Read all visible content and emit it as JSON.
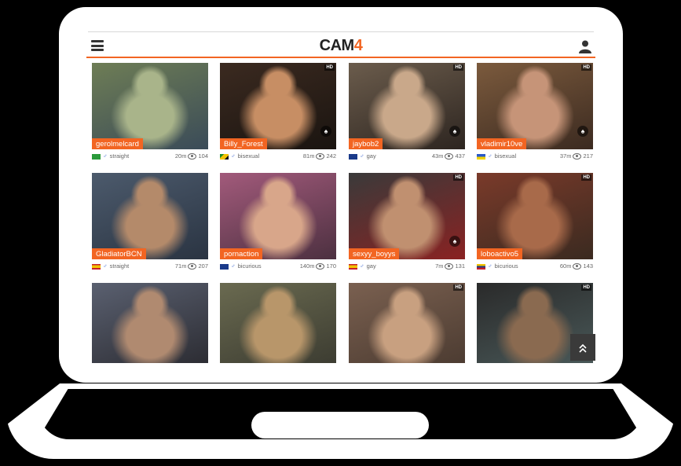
{
  "site": {
    "logo_main": "CAM",
    "logo_accent": "4",
    "accent_color": "#f26522"
  },
  "tiles": [
    {
      "name": "gerolmelcard",
      "flag": "br",
      "orientation": "straight",
      "time": "20m",
      "viewers": "104",
      "hd": "",
      "palette": [
        "#6e7d55",
        "#a9b48a",
        "#3a4b58"
      ]
    },
    {
      "name": "Billy_Forest",
      "flag": "jm",
      "orientation": "bisexual",
      "time": "81m",
      "viewers": "242",
      "hd": "HD",
      "palette": [
        "#3b2a20",
        "#c78e64",
        "#1a1410"
      ]
    },
    {
      "name": "jaybob2",
      "flag": "gb",
      "orientation": "gay",
      "time": "43m",
      "viewers": "437",
      "hd": "HD",
      "palette": [
        "#6b5c4c",
        "#c9a88a",
        "#2d2520"
      ]
    },
    {
      "name": "vladimir10ve",
      "flag": "ua",
      "orientation": "bisexual",
      "time": "37m",
      "viewers": "217",
      "hd": "HD",
      "palette": [
        "#7b5a3d",
        "#c69478",
        "#3b2a20"
      ]
    },
    {
      "name": "GladiatorBCN",
      "flag": "es",
      "orientation": "straight",
      "time": "71m",
      "viewers": "207",
      "hd": "",
      "palette": [
        "#4c5a6c",
        "#b48a6a",
        "#2a3442"
      ]
    },
    {
      "name": "pornaction",
      "flag": "gb",
      "orientation": "bicurious",
      "time": "140m",
      "viewers": "170",
      "hd": "",
      "palette": [
        "#a25a7b",
        "#d8a68a",
        "#4c3040"
      ]
    },
    {
      "name": "sexyy_boyys",
      "flag": "es",
      "orientation": "gay",
      "time": "7m",
      "viewers": "131",
      "hd": "HD",
      "palette": [
        "#3a3a3a",
        "#c09070",
        "#8a2222"
      ]
    },
    {
      "name": "loboactivo5",
      "flag": "ve",
      "orientation": "bicurious",
      "time": "60m",
      "viewers": "143",
      "hd": "HD",
      "palette": [
        "#7a3a2a",
        "#a86a4a",
        "#3a2a20"
      ]
    },
    {
      "name": "",
      "flag": "",
      "orientation": "",
      "time": "",
      "viewers": "",
      "hd": "",
      "palette": [
        "#5a6070",
        "#b08a70",
        "#2a2a30"
      ]
    },
    {
      "name": "",
      "flag": "",
      "orientation": "",
      "time": "",
      "viewers": "",
      "hd": "",
      "palette": [
        "#6a6a50",
        "#b8966a",
        "#3a3a30"
      ]
    },
    {
      "name": "",
      "flag": "",
      "orientation": "",
      "time": "",
      "viewers": "",
      "hd": "HD",
      "palette": [
        "#7a6050",
        "#c8a080",
        "#4a3a30"
      ]
    },
    {
      "name": "",
      "flag": "",
      "orientation": "",
      "time": "",
      "viewers": "",
      "hd": "HD",
      "palette": [
        "#2a2a2a",
        "#8a6a50",
        "#4a5a5a"
      ]
    }
  ],
  "scroll_top_icon": "double-chevron-up-icon"
}
